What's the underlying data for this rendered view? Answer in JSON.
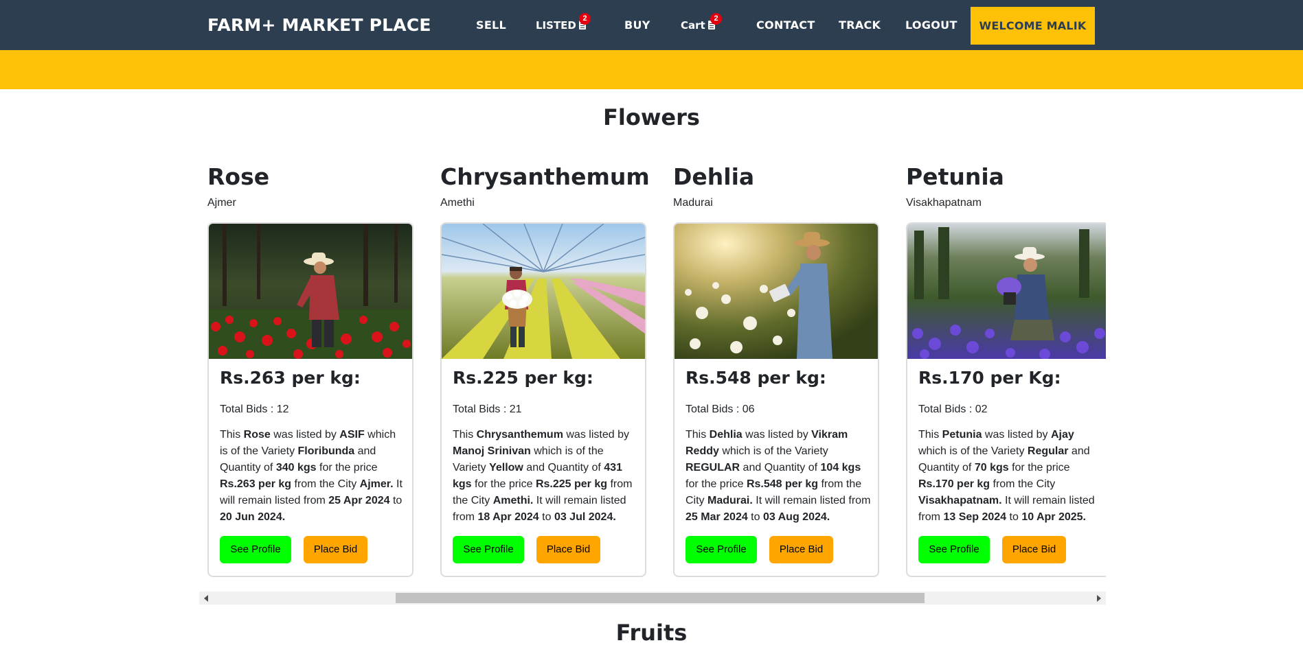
{
  "nav": {
    "brand": "FARM+ MARKET PLACE",
    "sell": "SELL",
    "listed": "LISTED",
    "listed_badge": "2",
    "buy": "BUY",
    "cart": "Cart",
    "cart_badge": "2",
    "contact": "CONTACT",
    "track": "TRACK",
    "logout": "LOGOUT",
    "welcome": "WELCOME MALIK"
  },
  "sections": {
    "flowers": "Flowers",
    "fruits": "Fruits"
  },
  "buttons": {
    "profile": "See Profile",
    "bid": "Place Bid"
  },
  "products": [
    {
      "name": "Rose",
      "city": "Ajmer",
      "price": "Rs.263 per kg:",
      "bids": "Total Bids : 12",
      "desc": {
        "t1": "This ",
        "item": "Rose",
        "t2": " was listed by ",
        "seller": "ASIF",
        "t3": " which is of the Variety ",
        "variety": "Floribunda",
        "t4": " and Quantity of ",
        "qty": "340 kgs",
        "t5": " for the price ",
        "rate": "Rs.263 per kg",
        "t6": " from the City ",
        "city": "Ajmer.",
        "t7": " It will remain listed from ",
        "from": "25 Apr 2024",
        "t8": " to ",
        "to": "20 Jun 2024."
      }
    },
    {
      "name": "Chrysanthemum",
      "city": "Amethi",
      "price": "Rs.225 per kg:",
      "bids": "Total Bids : 21",
      "desc": {
        "t1": "This ",
        "item": "Chrysanthemum",
        "t2": " was listed by ",
        "seller": "Manoj Srinivan",
        "t3": " which is of the Variety ",
        "variety": "Yellow",
        "t4": " and Quantity of ",
        "qty": "431 kgs",
        "t5": " for the price ",
        "rate": "Rs.225 per kg",
        "t6": " from the City ",
        "city": "Amethi.",
        "t7": " It will remain listed from ",
        "from": "18 Apr 2024",
        "t8": " to ",
        "to": "03 Jul 2024."
      }
    },
    {
      "name": "Dehlia",
      "city": "Madurai",
      "price": "Rs.548 per kg:",
      "bids": "Total Bids : 06",
      "desc": {
        "t1": "This ",
        "item": "Dehlia",
        "t2": " was listed by ",
        "seller": "Vikram Reddy",
        "t3": " which is of the Variety ",
        "variety": "REGULAR",
        "t4": " and Quantity of ",
        "qty": "104 kgs",
        "t5": " for the price ",
        "rate": "Rs.548 per kg",
        "t6": " from the City ",
        "city": "Madurai.",
        "t7": " It will remain listed from ",
        "from": "25 Mar 2024",
        "t8": " to ",
        "to": "03 Aug 2024."
      }
    },
    {
      "name": "Petunia",
      "city": "Visakhapatnam",
      "price": "Rs.170 per Kg:",
      "bids": "Total Bids : 02",
      "desc": {
        "t1": "This ",
        "item": "Petunia",
        "t2": " was listed by ",
        "seller": "Ajay",
        "t3": " which is of the Variety ",
        "variety": "Regular",
        "t4": " and Quantity of ",
        "qty": "70 kgs",
        "t5": " for the price ",
        "rate": "Rs.170 per kg",
        "t6": " from the City ",
        "city": "Visakhapatnam.",
        "t7": " It will remain listed from ",
        "from": "13 Sep 2024",
        "t8": " to ",
        "to": "10 Apr 2025."
      }
    }
  ]
}
